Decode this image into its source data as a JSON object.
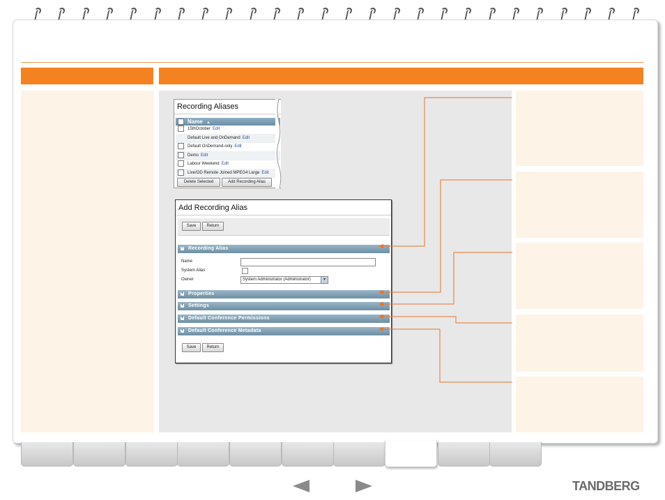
{
  "brand": {
    "name": "TANDBERG"
  },
  "colors": {
    "accent": "#f58220",
    "panel": "#fdf3e6",
    "section_bar": "#7b9bb1",
    "link": "#2a4d9a"
  },
  "aliases_window": {
    "title": "Recording Aliases",
    "column_header": "Name",
    "rows": [
      {
        "name": "15thOctober",
        "action": "Edit"
      },
      {
        "name": "Default Live and OnDemand",
        "action": "Edit"
      },
      {
        "name": "Default OnDemand-only",
        "action": "Edit"
      },
      {
        "name": "Demo",
        "action": "Edit"
      },
      {
        "name": "Labour Weekend",
        "action": "Edit"
      },
      {
        "name": "Live/OD Remote Joined MPEG4 Large",
        "action": "Edit"
      }
    ],
    "delete_label": "Delete Selected",
    "add_label": "Add Recording Alias"
  },
  "add_form": {
    "title": "Add Recording Alias",
    "save_label": "Save",
    "return_label": "Return",
    "sections": {
      "recording_alias": "Recording Alias",
      "properties": "Properties",
      "settings": "Settings",
      "permissions": "Default Conference Permissions",
      "metadata": "Default Conference Metadata"
    },
    "fields": {
      "name_label": "Name",
      "name_value": "",
      "system_alias_label": "System Alias",
      "owner_label": "Owner",
      "owner_value": "System Administrator (Administrator)"
    }
  },
  "icons": {
    "collapse": "minus-square-icon",
    "expand": "plus-square-icon",
    "sort": "sort-asc-icon",
    "dropdown": "chevron-down-icon",
    "prev": "arrow-left-icon",
    "next": "arrow-right-icon"
  }
}
